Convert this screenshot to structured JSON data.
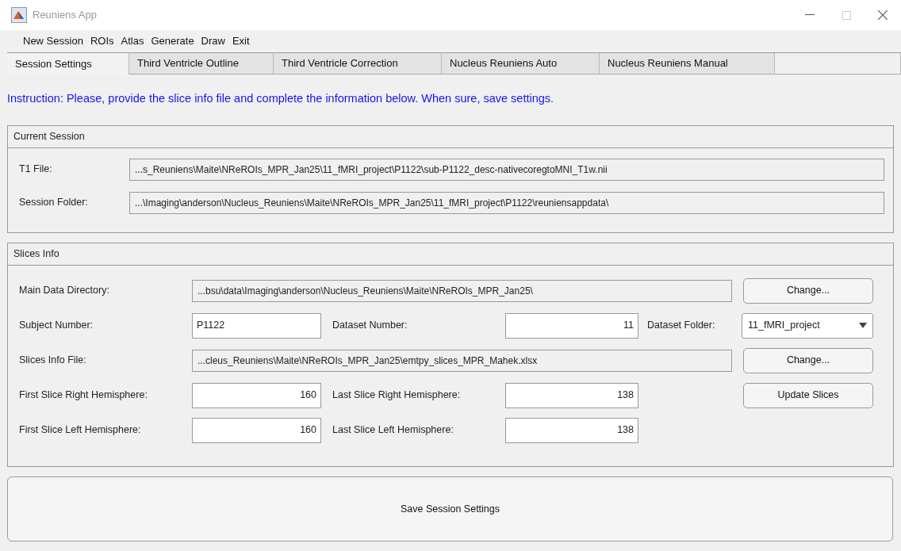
{
  "window": {
    "title": "Reuniens App",
    "maximize_disabled": true
  },
  "menu": [
    "New Session",
    "ROIs",
    "Atlas",
    "Generate",
    "Draw",
    "Exit"
  ],
  "tabs": [
    {
      "label": "Session Settings",
      "selected": true
    },
    {
      "label": "Third Ventricle Outline",
      "selected": false
    },
    {
      "label": "Third Ventricle Correction",
      "selected": false
    },
    {
      "label": "Nucleus Reuniens Auto",
      "selected": false
    },
    {
      "label": "Nucleus Reuniens Manual",
      "selected": false
    }
  ],
  "instruction": "Instruction: Please, provide the slice info file and complete the information below. When sure, save settings.",
  "current_session": {
    "title": "Current Session",
    "fields": [
      {
        "label": "T1 File:",
        "value": "...s_Reuniens\\Maite\\NReROIs_MPR_Jan25\\11_fMRI_project\\P1122\\sub-P1122_desc-nativecoregtoMNI_T1w.nii"
      },
      {
        "label": "Session Folder:",
        "value": "...\\Imaging\\anderson\\Nucleus_Reuniens\\Maite\\NReROIs_MPR_Jan25\\11_fMRI_project\\P1122\\reuniensappdata\\"
      }
    ]
  },
  "slices_info": {
    "title": "Slices Info",
    "main_data_directory": {
      "label": "Main Data Directory:",
      "value": "...bsu\\data\\Imaging\\anderson\\Nucleus_Reuniens\\Maite\\NReROIs_MPR_Jan25\\",
      "button": "Change..."
    },
    "subject_number": {
      "label": "Subject Number:",
      "value": "P1122"
    },
    "dataset_number": {
      "label": "Dataset Number:",
      "value": "11"
    },
    "dataset_folder": {
      "label": "Dataset Folder:",
      "value": "11_fMRI_project"
    },
    "slices_info_file": {
      "label": "Slices Info File:",
      "value": "...cleus_Reuniens\\Maite\\NReROIs_MPR_Jan25\\emtpy_slices_MPR_Mahek.xlsx",
      "button": "Change..."
    },
    "first_right": {
      "label": "First Slice Right Hemisphere:",
      "value": "160"
    },
    "last_right": {
      "label": "Last Slice Right Hemisphere:",
      "value": "138"
    },
    "update_button": "Update Slices",
    "first_left": {
      "label": "First Slice Left Hemisphere:",
      "value": "160"
    },
    "last_left": {
      "label": "Last Slice Left Hemisphere:",
      "value": "138"
    }
  },
  "save_button": "Save Session Settings"
}
